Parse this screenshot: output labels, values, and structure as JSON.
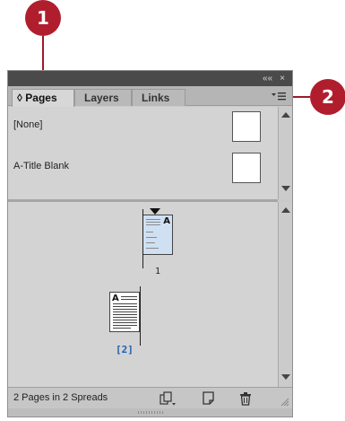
{
  "callouts": {
    "first": "1",
    "second": "2"
  },
  "panel": {
    "title_controls": {
      "collapse": "««",
      "close": "×"
    },
    "tabs": [
      {
        "label": "◊ Pages",
        "active": true
      },
      {
        "label": "Layers",
        "active": false
      },
      {
        "label": "Links",
        "active": false
      }
    ],
    "menu_icon": "panel-menu-icon",
    "masters": [
      {
        "label": "[None]"
      },
      {
        "label": "A-Title Blank"
      }
    ],
    "pages": [
      {
        "number": "1",
        "master_prefix": "A",
        "selected": true
      },
      {
        "number": "[2]",
        "master_prefix": "A",
        "selected": false
      }
    ],
    "status_text": "2 Pages in 2 Spreads",
    "colors": {
      "callout": "#b01e2e",
      "selected_page": "#cfe0f3",
      "selected_number": "#1a5fb4"
    }
  }
}
